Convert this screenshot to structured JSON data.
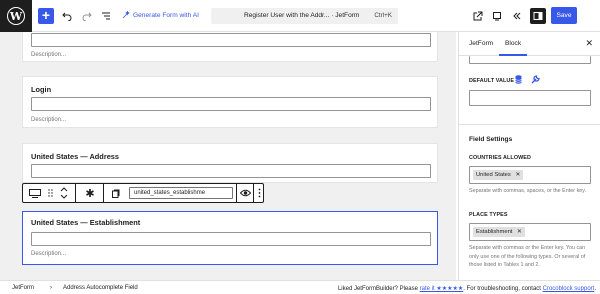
{
  "topbar": {
    "generate_label": "Generate Form with AI",
    "doc_title": "Register User with the Addr... · JetForm",
    "doc_shortcut": "Ctrl+K",
    "save_label": "Save"
  },
  "canvas": {
    "cards": [
      {
        "title": "",
        "description": "Description..."
      },
      {
        "title": "Login",
        "description": "Description..."
      },
      {
        "title": "United States — Address",
        "description": ""
      },
      {
        "title": "United States — Establishment",
        "description": "Description..."
      }
    ],
    "block_toolbar": {
      "field_name": "united_states_establishme"
    }
  },
  "sidebar": {
    "tabs": [
      {
        "label": "JetForm"
      },
      {
        "label": "Block"
      }
    ],
    "default_value_label": "DEFAULT VALUE",
    "field_settings_title": "Field Settings",
    "countries_label": "COUNTRIES ALLOWED",
    "countries_token": "United States",
    "countries_help": "Separate with commas, spaces, or the Enter key.",
    "place_types_label": "PLACE TYPES",
    "place_types_token": "Establishment",
    "place_types_help": "Separate with commas or the Enter key. You can only use one of the following types. Or several of those listed in Tables 1 and 2."
  },
  "footer": {
    "breadcrumbs": [
      "JetForm",
      "Address Autocomplete Field"
    ],
    "liked_prefix": "Liked JetFormBuilder? Please ",
    "rate_link": "rate it ★★★★★",
    "troubleshoot_text": ". For troubleshooting, contact ",
    "support_link": "Crocoblock support",
    "suffix": "."
  },
  "colors": {
    "accent": "#3858e9",
    "dark": "#1e1e1e",
    "canvas_bg": "#f0f0f0"
  }
}
